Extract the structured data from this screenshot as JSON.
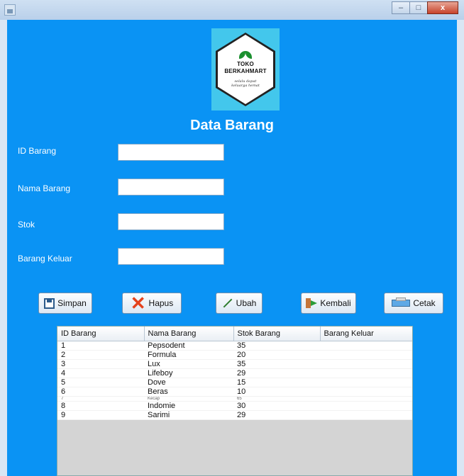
{
  "window": {
    "minimize": "–",
    "maximize": "□",
    "close": "x"
  },
  "logo": {
    "line1": "TOKO",
    "line2": "BERKAHMART",
    "tagline": "selalu dapat keluarga hemat"
  },
  "title": "Data Barang",
  "form": {
    "id_label": "ID Barang",
    "id_value": "",
    "nama_label": "Nama Barang",
    "nama_value": "",
    "stok_label": "Stok",
    "stok_value": "",
    "keluar_label": "Barang Keluar",
    "keluar_value": ""
  },
  "buttons": {
    "simpan": "Simpan",
    "hapus": "Hapus",
    "ubah": "Ubah",
    "kembali": "Kembali",
    "cetak": "Cetak"
  },
  "icons": {
    "save": "save-icon",
    "delete": "x-icon",
    "edit": "pencil-icon",
    "back": "exit-door-icon",
    "print": "printer-icon"
  },
  "table": {
    "headers": [
      "ID Barang",
      "Nama Barang",
      "Stok Barang",
      "Barang Keluar"
    ],
    "rows": [
      [
        "1",
        "Pepsodent",
        "35",
        ""
      ],
      [
        "2",
        "Formula",
        "20",
        ""
      ],
      [
        "3",
        "Lux",
        "35",
        ""
      ],
      [
        "4",
        "Lifeboy",
        "29",
        ""
      ],
      [
        "5",
        "Dove",
        "15",
        ""
      ],
      [
        "6",
        "Beras",
        "10",
        ""
      ],
      [
        "7",
        "Kecap",
        "65",
        ""
      ],
      [
        "8",
        "Indomie",
        "30",
        ""
      ],
      [
        "9",
        "Sarimi",
        "29",
        ""
      ]
    ]
  },
  "colors": {
    "panel": "#0a93f4",
    "logo_bg": "#43c7ec"
  }
}
